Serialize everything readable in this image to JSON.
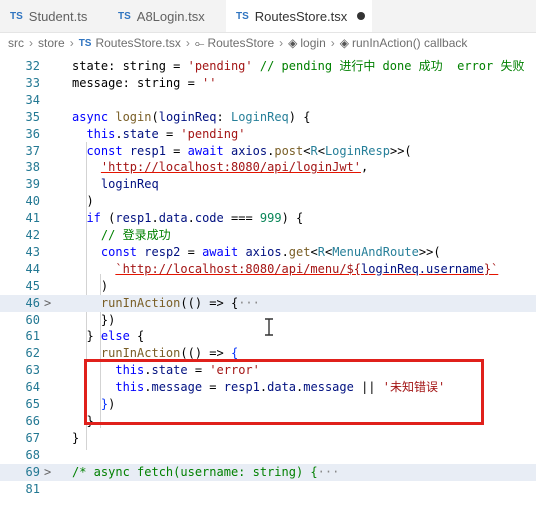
{
  "tabs": [
    {
      "icon": "TS",
      "label": "Student.ts"
    },
    {
      "icon": "TS",
      "label": "A8Login.tsx"
    },
    {
      "icon": "TS",
      "label": "RoutesStore.tsx"
    }
  ],
  "breadcrumb": [
    "src",
    "store",
    "RoutesStore.tsx",
    "RoutesStore",
    "login",
    "runInAction() callback"
  ],
  "breadcrumb_ts": "TS",
  "lines": [
    {
      "n": "32",
      "fold": "",
      "collapsed": false,
      "html": "state: string = <span class='str'>'pending'</span> <span class='cm'>// pending 进行中 done 成功  error 失败</span>"
    },
    {
      "n": "33",
      "fold": "",
      "collapsed": false,
      "html": "message: string = <span class='str'>''</span>"
    },
    {
      "n": "34",
      "fold": "",
      "collapsed": false,
      "html": ""
    },
    {
      "n": "35",
      "fold": "",
      "collapsed": false,
      "html": "<span class='kw'>async</span> <span class='fn'>login</span>(<span class='vr'>loginReq</span>: <span class='ty'>LoginReq</span>) {"
    },
    {
      "n": "36",
      "fold": "",
      "collapsed": false,
      "html": "  <span class='kw'>this</span>.<span class='vr'>state</span> = <span class='str'>'pending'</span>"
    },
    {
      "n": "37",
      "fold": "",
      "collapsed": false,
      "html": "  <span class='kw'>const</span> <span class='vr'>resp1</span> = <span class='kw'>await</span> <span class='vr'>axios</span>.<span class='fn'>post</span>&lt;<span class='ty'>R</span>&lt;<span class='ty'>LoginResp</span>&gt;&gt;("
    },
    {
      "n": "38",
      "fold": "",
      "collapsed": false,
      "html": "    <span class='url'>'http://localhost:8080/api/loginJwt'</span>,"
    },
    {
      "n": "39",
      "fold": "",
      "collapsed": false,
      "html": "    <span class='vr'>loginReq</span>"
    },
    {
      "n": "40",
      "fold": "",
      "collapsed": false,
      "html": "  )"
    },
    {
      "n": "41",
      "fold": "",
      "collapsed": false,
      "html": "  <span class='kw'>if</span> (<span class='vr'>resp1</span>.<span class='vr'>data</span>.<span class='vr'>code</span> === <span class='num'>999</span>) {"
    },
    {
      "n": "42",
      "fold": "",
      "collapsed": false,
      "html": "    <span class='cm'>// 登录成功</span>"
    },
    {
      "n": "43",
      "fold": "",
      "collapsed": false,
      "html": "    <span class='kw'>const</span> <span class='vr'>resp2</span> = <span class='kw'>await</span> <span class='vr'>axios</span>.<span class='fn'>get</span>&lt;<span class='ty'>R</span>&lt;<span class='ty'>MenuAndRoute</span>&gt;&gt;("
    },
    {
      "n": "44",
      "fold": "",
      "collapsed": false,
      "html": "      <span class='url'>`http://localhost:8080/api/menu/${</span><span class='vr' style='text-decoration:underline;text-decoration-color:#e51400'>loginReq.username</span><span class='url'>}`</span>"
    },
    {
      "n": "45",
      "fold": "",
      "collapsed": false,
      "html": "    )"
    },
    {
      "n": "46",
      "fold": ">",
      "collapsed": true,
      "html": "    <span class='fn'>runInAction</span>(() =&gt; {<span style='color:#888'>···</span>"
    },
    {
      "n": "60",
      "fold": "",
      "collapsed": false,
      "html": "    })"
    },
    {
      "n": "61",
      "fold": "",
      "collapsed": false,
      "html": "  } <span class='kw'>else</span> {"
    },
    {
      "n": "62",
      "fold": "",
      "collapsed": false,
      "html": "    <span class='fn'>runInAction</span>(() =&gt; <span class='bp'>{</span>"
    },
    {
      "n": "63",
      "fold": "",
      "collapsed": false,
      "html": "      <span class='kw'>this</span>.<span class='vr'>state</span> = <span class='str'>'error'</span>"
    },
    {
      "n": "64",
      "fold": "",
      "collapsed": false,
      "html": "      <span class='kw'>this</span>.<span class='vr'>message</span> = <span class='vr'>resp1</span>.<span class='vr'>data</span>.<span class='vr'>message</span> || <span class='str'>'未知错误'</span>"
    },
    {
      "n": "65",
      "fold": "",
      "collapsed": false,
      "html": "    <span class='bp'>}</span>)"
    },
    {
      "n": "66",
      "fold": "",
      "collapsed": false,
      "html": "  }"
    },
    {
      "n": "67",
      "fold": "",
      "collapsed": false,
      "html": "}"
    },
    {
      "n": "68",
      "fold": "",
      "collapsed": false,
      "html": ""
    },
    {
      "n": "69",
      "fold": ">",
      "collapsed": true,
      "html": "<span class='cm'>/* async fetch(username: string) {</span><span style='color:#888'>···</span>"
    },
    {
      "n": "81",
      "fold": "",
      "collapsed": false,
      "html": ""
    }
  ]
}
